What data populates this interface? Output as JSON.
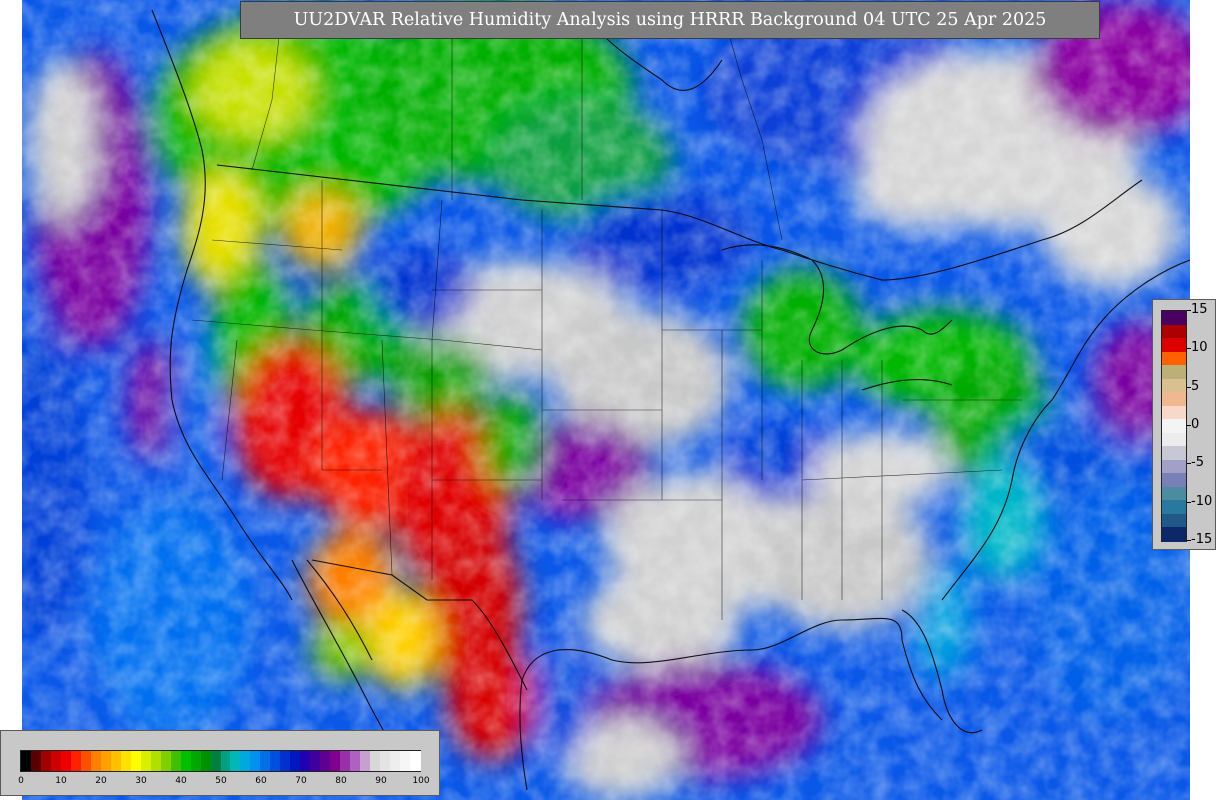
{
  "header": {
    "title": "UU2DVAR Relative Humidity Analysis using HRRR Background 04 UTC 25 Apr 2025"
  },
  "rh_legend": {
    "ticks": [
      "0",
      "10",
      "20",
      "30",
      "40",
      "50",
      "60",
      "70",
      "80",
      "90",
      "100"
    ],
    "colors": [
      "#000000",
      "#5a0000",
      "#a00000",
      "#d00000",
      "#ee0000",
      "#ff2000",
      "#ff5000",
      "#ff8000",
      "#ffa000",
      "#ffc000",
      "#ffe000",
      "#ffff00",
      "#d8f000",
      "#b0e000",
      "#80d000",
      "#40c000",
      "#00c000",
      "#00a800",
      "#009000",
      "#008040",
      "#00a080",
      "#00b8b8",
      "#00a8e0",
      "#0090f0",
      "#0070e8",
      "#0050e0",
      "#0030d0",
      "#0018c0",
      "#2000b0",
      "#4000a0",
      "#600090",
      "#800090",
      "#9a30a8",
      "#b060c0",
      "#c8a0d0",
      "#d8d8d8",
      "#e4e4e4",
      "#eeeeee",
      "#f6f6f6",
      "#ffffff"
    ]
  },
  "anomaly_legend": {
    "ticks": [
      "15",
      "10",
      "5",
      "0",
      "-5",
      "-10",
      "-15"
    ],
    "colors": [
      "#4a0060",
      "#aa0000",
      "#dd0000",
      "#ff6000",
      "#bcb078",
      "#d8c090",
      "#f0b890",
      "#f8d8c8",
      "#f4f4f4",
      "#ececec",
      "#c8c8d4",
      "#a0a0c8",
      "#7880b8",
      "#4c8ca0",
      "#2878a0",
      "#205888",
      "#0c2868"
    ]
  },
  "map_icons": {
    "basemap": "conus-map-icon"
  }
}
